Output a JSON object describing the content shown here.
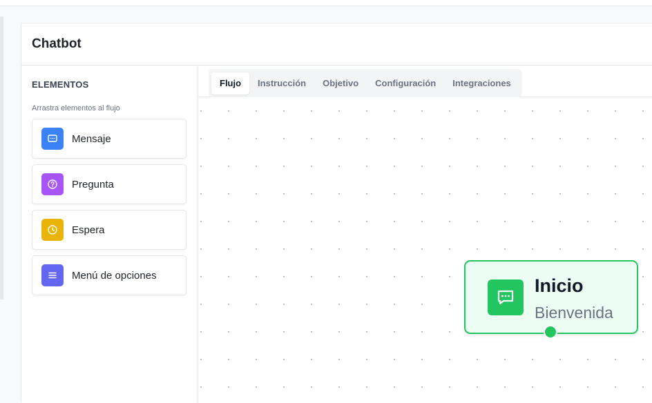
{
  "header": {
    "title": "Chatbot"
  },
  "sidebar": {
    "title": "ELEMENTOS",
    "hint": "Arrastra elementos al flujo",
    "items": [
      {
        "label": "Mensaje",
        "icon": "message-icon",
        "color": "#3b82f6"
      },
      {
        "label": "Pregunta",
        "icon": "question-icon",
        "color": "#a855f7"
      },
      {
        "label": "Espera",
        "icon": "clock-icon",
        "color": "#eab308"
      },
      {
        "label": "Menú de opciones",
        "icon": "menu-icon",
        "color": "#6366f1"
      }
    ]
  },
  "tabs": [
    {
      "label": "Flujo",
      "active": true
    },
    {
      "label": "Instrucción",
      "active": false
    },
    {
      "label": "Objetivo",
      "active": false
    },
    {
      "label": "Configuración",
      "active": false
    },
    {
      "label": "Integraciones",
      "active": false
    }
  ],
  "flow": {
    "start_node": {
      "title": "Inicio",
      "subtitle": "Bienvenida",
      "icon": "chat-icon",
      "color": "#22c55e"
    }
  }
}
